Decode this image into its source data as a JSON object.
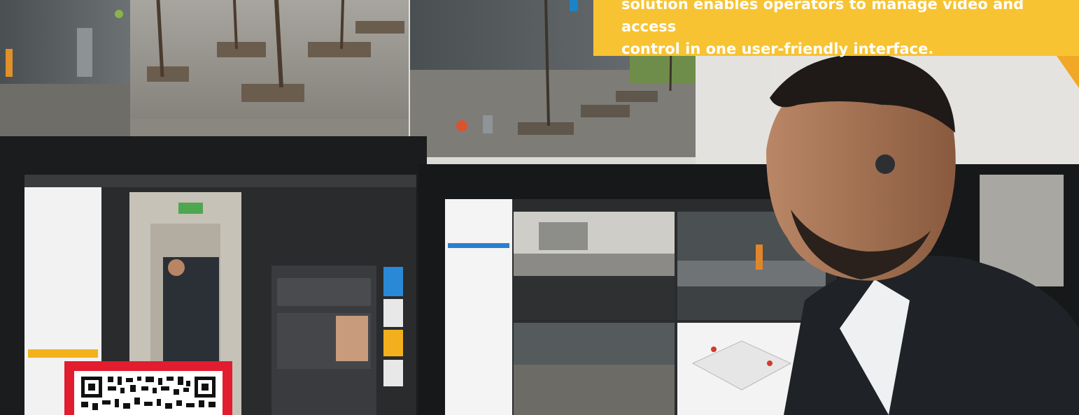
{
  "photo": {
    "description_icon": "operator-at-multi-monitor-video-wall-photo"
  },
  "callout": {
    "line1": "solution enables operators to manage video and access",
    "line2": "control in one user-friendly interface.",
    "color": "#f7c332",
    "text_color": "#ffffff"
  },
  "qr": {
    "icon": "qr-code-icon",
    "frame_color": "#e11d2f"
  },
  "accent": {
    "blue": "#1b84c7"
  }
}
